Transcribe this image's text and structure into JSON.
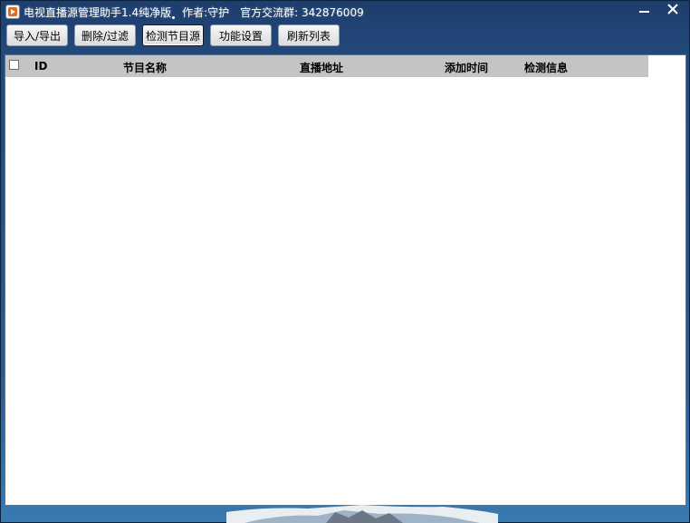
{
  "window": {
    "title": "电视直播源管理助手1.4纯净版",
    "author": "作者:守护",
    "group": "官方交流群: 342876009"
  },
  "toolbar": {
    "import_export": "导入/导出",
    "delete_filter": "删除/过滤",
    "check_source": "检测节目源",
    "settings": "功能设置",
    "refresh": "刷新列表"
  },
  "list": {
    "columns": [
      "ID",
      "节目名称",
      "直播地址",
      "添加时间",
      "检测信息"
    ],
    "rows": []
  },
  "colors": {
    "titlebar": "#1e3d6b",
    "header_bg": "#c4c4c4"
  }
}
